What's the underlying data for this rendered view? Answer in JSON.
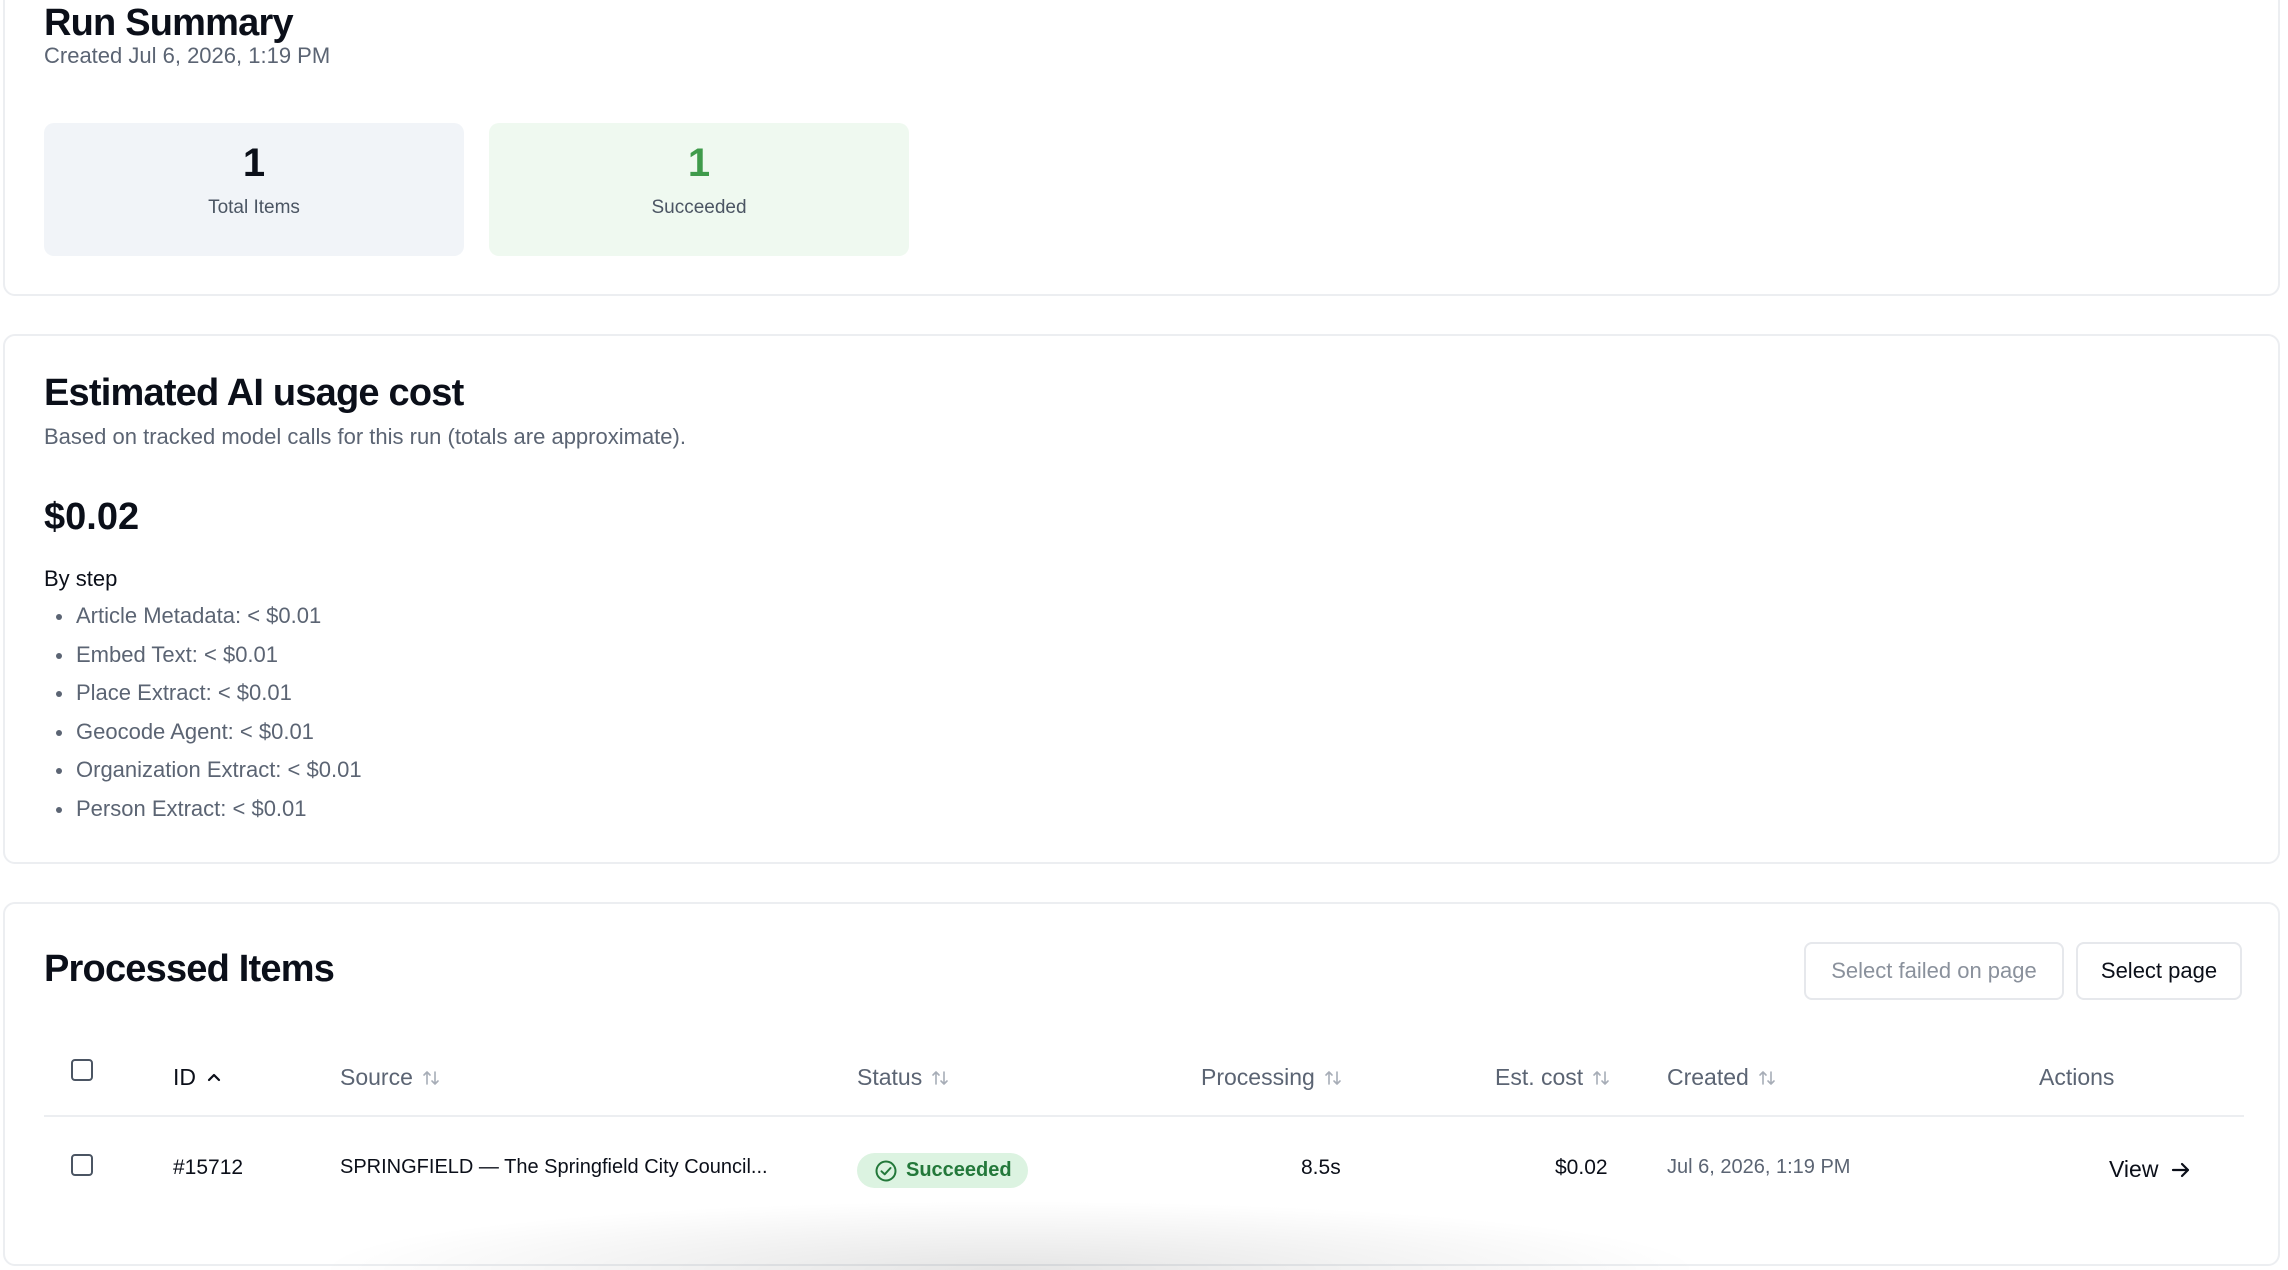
{
  "summary": {
    "title": "Run Summary",
    "created": "Created Jul 6, 2026, 1:19 PM",
    "stats": [
      {
        "value": "1",
        "label": "Total Items"
      },
      {
        "value": "1",
        "label": "Succeeded",
        "color": "#3f9b4b"
      }
    ]
  },
  "cost": {
    "title": "Estimated AI usage cost",
    "subtitle": "Based on tracked model calls for this run (totals are approximate).",
    "total": "$0.02",
    "by_step_label": "By step",
    "steps": [
      "Article Metadata: < $0.01",
      "Embed Text: < $0.01",
      "Place Extract: < $0.01",
      "Geocode Agent: < $0.01",
      "Organization Extract: < $0.01",
      "Person Extract: < $0.01"
    ]
  },
  "items": {
    "title": "Processed Items",
    "buttons": {
      "select_failed": "Select failed on page",
      "select_page": "Select page"
    },
    "columns": {
      "id": "ID",
      "source": "Source",
      "status": "Status",
      "processing": "Processing",
      "cost": "Est. cost",
      "created": "Created",
      "actions": "Actions"
    },
    "sort": {
      "column": "ID",
      "direction": "ascending"
    },
    "rows": [
      {
        "id": "#15712",
        "source": "SPRINGFIELD — The Springfield City Council...",
        "status": "Succeeded",
        "processing": "8.5s",
        "cost": "$0.02",
        "created": "Jul 6, 2026, 1:19 PM",
        "action": "View",
        "checked": false
      }
    ],
    "header_checked": false
  },
  "colors": {
    "success_text": "#23783a",
    "success_bg": "#dcf3e1",
    "muted": "#5b6473"
  }
}
